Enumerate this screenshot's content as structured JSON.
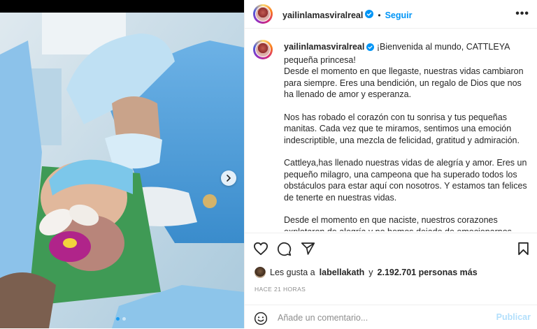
{
  "post": {
    "username": "yailinlamasviralreal",
    "follow_label": "Seguir",
    "more_label": "•••",
    "caption_first": "¡Bienvenida al mundo, CATTLEYA pequeña princesa!",
    "caption_paragraphs": [
      "Desde el momento en que llegaste, nuestras vidas cambiaron para siempre. Eres una bendición, un regalo de Dios que nos ha llenado de amor y esperanza.",
      "Nos has robado el corazón con tu sonrisa y tus pequeñas manitas. Cada vez que te miramos, sentimos una emoción indescriptible, una mezcla de felicidad, gratitud y admiración.",
      "Cattleya,has llenado nuestras vidas de alegría y amor. Eres un pequeño milagro, una campeona que ha superado todos los obstáculos para estar aquí con nosotros. Y estamos tan felices de tenerte en nuestras vidas.",
      "Desde el momento en que naciste, nuestros corazones explotaron de alegría y no hemos dejado de emocionarnos cada vez que te miramos. Eres la personita más especial y maravillosa"
    ],
    "likes": {
      "prefix": "Les gusta a",
      "user": "labellakath",
      "joiner": "y",
      "count": "2.192.701 personas más"
    },
    "timestamp": "HACE 21 HORAS",
    "comment": {
      "placeholder": "Añade un comentario...",
      "publish_label": "Publicar"
    }
  },
  "carousel": {
    "slide_count": 2,
    "current_slide": 1
  },
  "icons": [
    "verified-badge-icon",
    "heart-icon",
    "comment-icon",
    "share-icon",
    "bookmark-icon",
    "emoji-icon",
    "chevron-right-icon",
    "more-options-icon"
  ],
  "colors": {
    "accent": "#0095f6",
    "publish_disabled": "#b2dffc",
    "muted": "#8e8e8e",
    "text": "#262626",
    "divider": "#efefef"
  }
}
